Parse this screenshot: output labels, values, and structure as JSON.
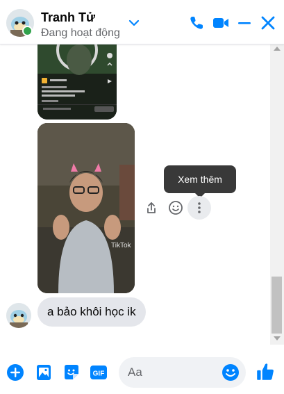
{
  "header": {
    "contact_name": "Tranh Tử",
    "status": "Đang hoạt động"
  },
  "media": {
    "tiktok_watermark": "TikTok"
  },
  "tooltip": {
    "text": "Xem thêm"
  },
  "messages": [
    {
      "text": "a bảo khôi học ik"
    }
  ],
  "composer": {
    "placeholder": "Aa"
  },
  "colors": {
    "accent": "#0084ff",
    "online": "#31a24c",
    "bubble": "#e4e6eb"
  },
  "icons": {
    "header": [
      "chevron-down-icon",
      "phone-icon",
      "video-icon",
      "minimize-icon",
      "close-icon"
    ],
    "actions": [
      "share-icon",
      "emoji-react-icon",
      "more-options-icon"
    ],
    "composer": [
      "add-icon",
      "image-icon",
      "sticker-icon",
      "gif-icon",
      "emoji-icon",
      "like-icon"
    ]
  }
}
